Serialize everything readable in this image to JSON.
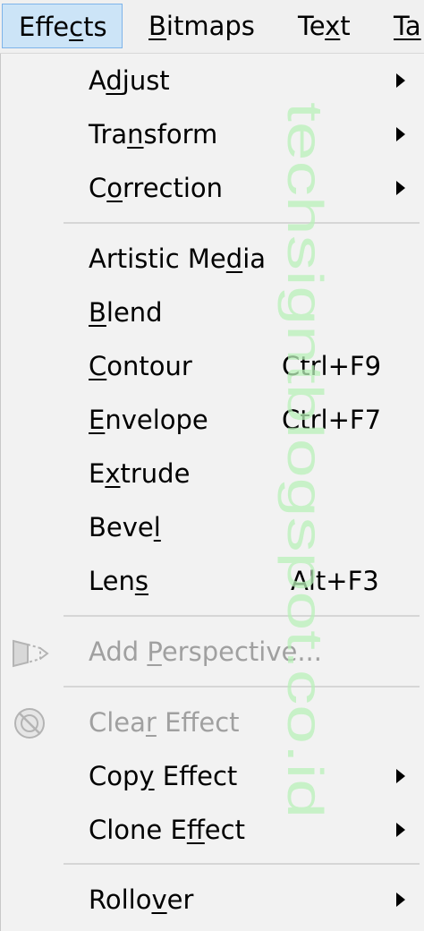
{
  "menubar": {
    "effects": [
      "Effe",
      "c",
      "ts"
    ],
    "bitmaps": [
      "",
      "B",
      "itmaps"
    ],
    "text": [
      "Te",
      "x",
      "t"
    ],
    "table": [
      "",
      "Ta",
      ""
    ]
  },
  "menu": {
    "adjust": [
      "A",
      "d",
      "just"
    ],
    "transform": [
      "Tra",
      "n",
      "sform"
    ],
    "correction": [
      "C",
      "o",
      "rrection"
    ],
    "artistic_media": [
      "Artistic Me",
      "d",
      "ia"
    ],
    "blend": [
      "",
      "B",
      "lend"
    ],
    "contour": [
      "",
      "C",
      "ontour"
    ],
    "contour_shortcut": "Ctrl+F9",
    "envelope": [
      "",
      "E",
      "nvelope"
    ],
    "envelope_shortcut": "Ctrl+F7",
    "extrude": [
      "E",
      "x",
      "trude"
    ],
    "bevel": [
      "Beve",
      "l",
      ""
    ],
    "lens": [
      "Len",
      "s",
      ""
    ],
    "lens_shortcut": "Alt+F3",
    "add_perspective": [
      "Add ",
      "P",
      "erspective..."
    ],
    "clear_effect": [
      "Clea",
      "r",
      " Effect"
    ],
    "copy_effect": [
      "Cop",
      "y",
      " Effect"
    ],
    "clone_effect": [
      "Clone E",
      "f",
      "fect"
    ],
    "rollover": [
      "Rollo",
      "v",
      "er"
    ]
  },
  "watermark": "techsigntblogspot.co.id",
  "colors": {
    "highlight": "#cce4f7",
    "disabled_text": "#a0a0a0",
    "watermark": "#b8f0b8"
  }
}
